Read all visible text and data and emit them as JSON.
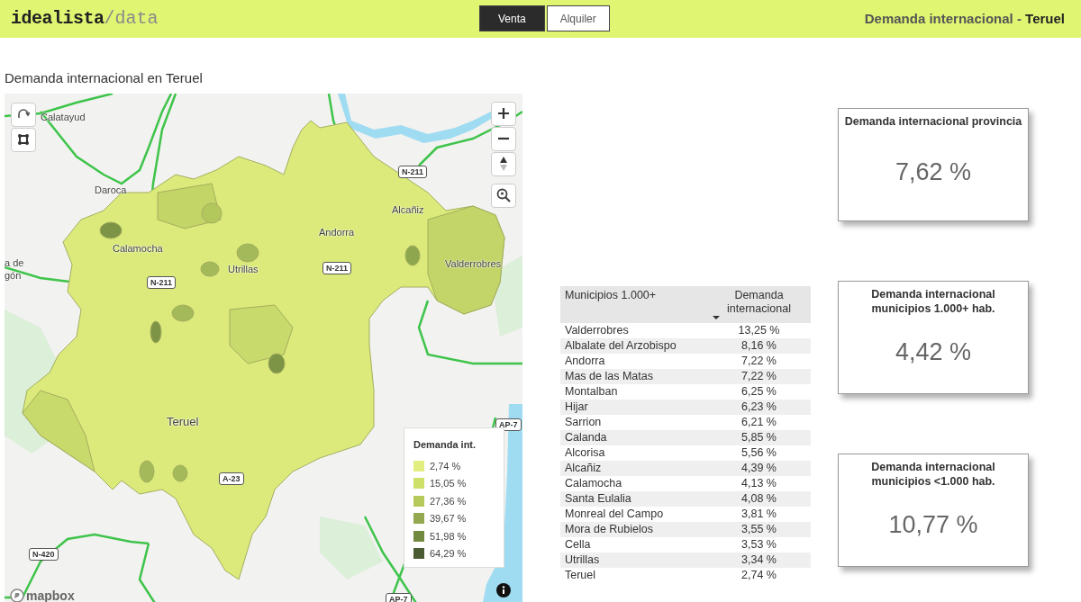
{
  "header": {
    "logo": {
      "main": "idealista",
      "sub": "/data"
    },
    "tabs": [
      {
        "label": "Venta",
        "selected": true
      },
      {
        "label": "Alquiler",
        "selected": false
      }
    ],
    "title": "Demanda internacional - **Teruel**"
  },
  "map": {
    "title": "Demanda internacional en Teruel",
    "places": [
      {
        "name": "Calatayud",
        "kind": "city"
      },
      {
        "name": "Daroca",
        "kind": "city"
      },
      {
        "name": "Calamocha",
        "kind": "city"
      },
      {
        "name": "Utrillas",
        "kind": "city"
      },
      {
        "name": "Andorra",
        "kind": "city"
      },
      {
        "name": "Alcañiz",
        "kind": "city"
      },
      {
        "name": "Valderrobres",
        "kind": "city"
      },
      {
        "name": "Teruel",
        "kind": "city"
      },
      {
        "name": "N-211",
        "kind": "road"
      },
      {
        "name": "N-211",
        "kind": "road"
      },
      {
        "name": "N-211",
        "kind": "road"
      },
      {
        "name": "A-23",
        "kind": "road"
      },
      {
        "name": "N-420",
        "kind": "road"
      },
      {
        "name": "AP-7",
        "kind": "road"
      },
      {
        "name": "AP-7",
        "kind": "road"
      },
      {
        "name": "a de",
        "kind": "area"
      },
      {
        "name": "gón",
        "kind": "area"
      }
    ],
    "legend": {
      "title": "Demanda int.",
      "items": [
        {
          "label": "2,74 %",
          "color": "#e2ef80"
        },
        {
          "label": "15,05 %",
          "color": "#cfe068"
        },
        {
          "label": "27,36 %",
          "color": "#b6c95b"
        },
        {
          "label": "39,67 %",
          "color": "#94a94f"
        },
        {
          "label": "51,98 %",
          "color": "#718a3f"
        },
        {
          "label": "64,29 %",
          "color": "#4b5c33"
        }
      ]
    },
    "attribution": "mapbox"
  },
  "table": {
    "columns": [
      {
        "label": "Municipios 1.000+",
        "sorted": false
      },
      {
        "label": "Demanda internacional",
        "sorted": true
      }
    ],
    "rows": [
      {
        "name": "Valderrobres",
        "value": "13,25 %"
      },
      {
        "name": "Albalate del Arzobispo",
        "value": "8,16 %"
      },
      {
        "name": "Andorra",
        "value": "7,22 %"
      },
      {
        "name": "Mas de las Matas",
        "value": "7,22 %"
      },
      {
        "name": "Montalban",
        "value": "6,25 %"
      },
      {
        "name": "Hijar",
        "value": "6,23 %"
      },
      {
        "name": "Sarrion",
        "value": "6,21 %"
      },
      {
        "name": "Calanda",
        "value": "5,85 %"
      },
      {
        "name": "Alcorisa",
        "value": "5,56 %"
      },
      {
        "name": "Alcañiz",
        "value": "4,39 %"
      },
      {
        "name": "Calamocha",
        "value": "4,13 %"
      },
      {
        "name": "Santa Eulalia",
        "value": "4,08 %"
      },
      {
        "name": "Monreal del Campo",
        "value": "3,81 %"
      },
      {
        "name": "Mora de Rubielos",
        "value": "3,55 %"
      },
      {
        "name": "Cella",
        "value": "3,53 %"
      },
      {
        "name": "Utrillas",
        "value": "3,34 %"
      },
      {
        "name": "Teruel",
        "value": "2,74 %"
      }
    ]
  },
  "cards": [
    {
      "title": "Demanda internacional provincia",
      "value": "7,62 %"
    },
    {
      "title": "Demanda internacional municipios 1.000+ hab.",
      "value": "4,42 %"
    },
    {
      "title": "Demanda internacional municipios <1.000 hab.",
      "value": "10,77 %"
    }
  ]
}
